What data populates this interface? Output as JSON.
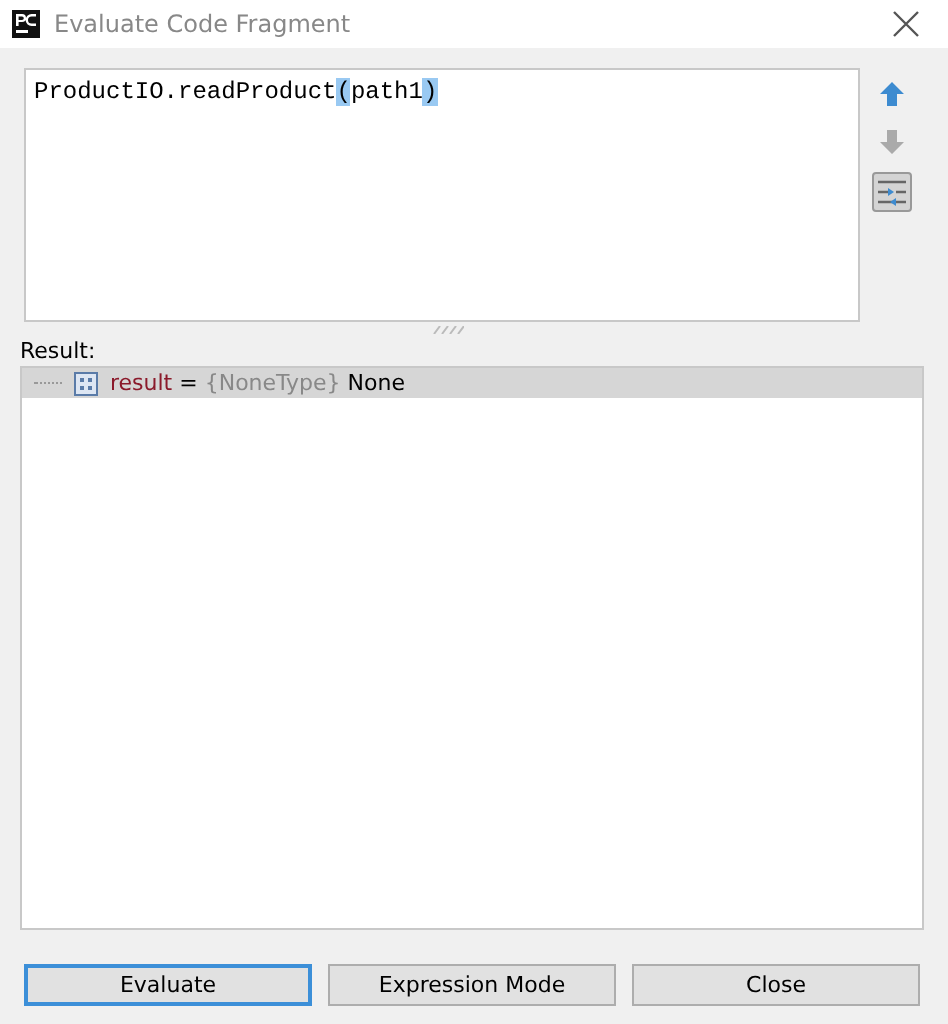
{
  "window": {
    "title": "Evaluate Code Fragment"
  },
  "editor": {
    "code": [
      {
        "text": "ProductIO.readProduct",
        "highlighted": false
      },
      {
        "text": "(",
        "highlighted": true
      },
      {
        "text": "path1",
        "highlighted": false
      },
      {
        "text": ")",
        "highlighted": true
      }
    ]
  },
  "side_tools": [
    {
      "kind": "up",
      "disabled": false
    },
    {
      "kind": "down",
      "disabled": true
    },
    {
      "kind": "toggle",
      "on": true
    }
  ],
  "result": {
    "label": "Result:",
    "rows": [
      {
        "name": "result",
        "equals": "=",
        "type": "{NoneType}",
        "value": "None",
        "selected": true
      }
    ]
  },
  "buttons": [
    {
      "label": "Evaluate",
      "focused": true
    },
    {
      "label": "Expression Mode",
      "focused": false
    },
    {
      "label": "Close",
      "focused": false
    }
  ]
}
